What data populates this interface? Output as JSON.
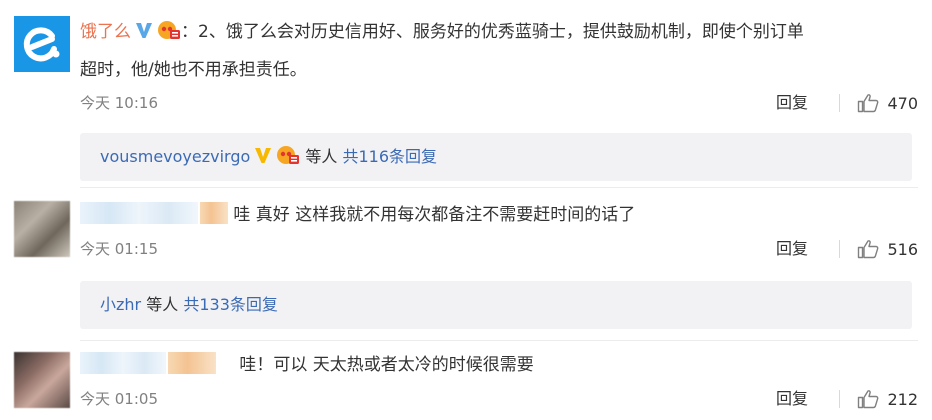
{
  "comments": [
    {
      "username": "饿了么",
      "colon": "：",
      "text_line1": "2、饿了么会对历史信用好、服务好的优秀蓝骑士，提供鼓励机制，即使个别订单",
      "text_line2": "超时，他/她也不用承担责任。",
      "time": "今天 10:16",
      "reply_label": "回复",
      "likes": "470",
      "sub": {
        "user": "vousmevoyezvirgo",
        "etc": "等人",
        "link": "共116条回复"
      }
    },
    {
      "text": "哇 真好  这样我就不用每次都备注不需要赶时间的话了",
      "time": "今天 01:15",
      "reply_label": "回复",
      "likes": "516",
      "sub": {
        "user": "小zhr",
        "etc": "等人",
        "link": "共133条回复"
      }
    },
    {
      "text": "哇！可以 天太热或者太冷的时候很需要",
      "time": "今天 01:05",
      "reply_label": "回复",
      "likes": "212"
    }
  ],
  "colors": {
    "username": "#eb7350",
    "link": "#3b6ab5",
    "brand": "#1996e6"
  },
  "icons": [
    "eleme-logo-icon",
    "verified-v-icon",
    "vip-crown-icon",
    "thumbs-up-icon"
  ]
}
